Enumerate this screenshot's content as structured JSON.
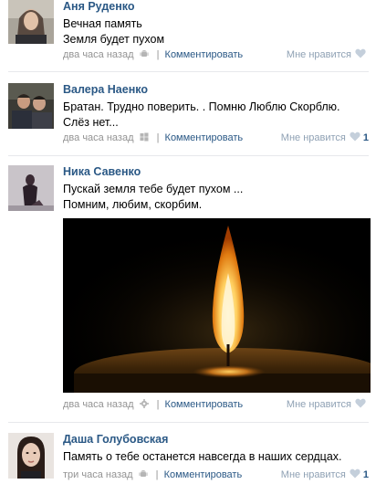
{
  "comments": [
    {
      "author": "Аня Руденко",
      "lines": [
        "Вечная память",
        "Земля будет пухом"
      ],
      "time": "два часа назад",
      "device": "android-icon",
      "reply_label": "Комментировать",
      "like_label": "Мне нравится",
      "like_count": ""
    },
    {
      "author": "Валера Наенко",
      "lines": [
        "Братан. Трудно поверить. . Помню Люблю Скорблю.",
        "Слёз нет..."
      ],
      "time": "два часа назад",
      "device": "windows-icon",
      "reply_label": "Комментировать",
      "like_label": "Мне нравится",
      "like_count": "1"
    },
    {
      "author": "Ника Савенко",
      "lines": [
        "Пускай земля тебе будет пухом ...",
        "Помним, любим, скорбим."
      ],
      "time": "два часа назад",
      "device": "gear-icon",
      "reply_label": "Комментировать",
      "like_label": "Мне нравится",
      "like_count": ""
    },
    {
      "author": "Даша Голубовская",
      "lines": [
        "Память о тебе останется навсегда в наших сердцах."
      ],
      "time": "три часа назад",
      "device": "android-icon",
      "reply_label": "Комментировать",
      "like_label": "Мне нравится",
      "like_count": "1"
    }
  ],
  "colors": {
    "link": "#2a5885",
    "meta": "#939393",
    "like": "#8fa1b4",
    "divider": "#e7e8ec"
  }
}
